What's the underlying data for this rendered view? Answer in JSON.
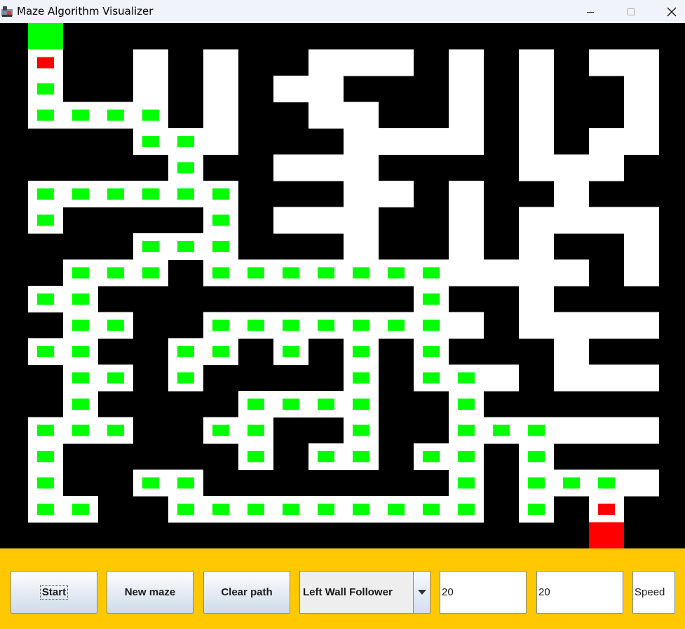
{
  "window": {
    "title": "Maze Algorithm Visualizer",
    "controls": {
      "minimize_icon": "minimize-icon",
      "maximize_icon": "maximize-icon",
      "close_icon": "close-icon"
    }
  },
  "maze": {
    "colors": {
      "wall": "#000000",
      "open": "#ffffff",
      "visited": "#00ff00",
      "start": "#00ff00",
      "end": "#ff0000",
      "marker": "#ff0000"
    }
  },
  "controls": {
    "start_label": "Start",
    "new_maze_label": "New maze",
    "clear_path_label": "Clear path",
    "algorithm": {
      "selected": "Left Wall Follower",
      "arrow_icon": "triangle-down-icon"
    },
    "rows_value": "20",
    "cols_value": "20",
    "speed_value": "Speed",
    "panel_color": "#ffc800"
  }
}
